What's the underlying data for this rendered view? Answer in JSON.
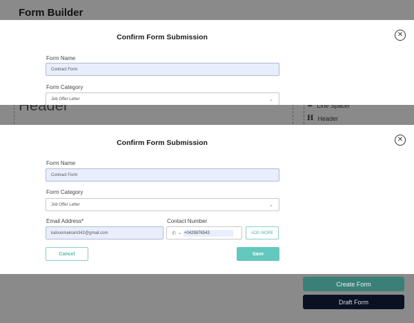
{
  "app": {
    "title": "Form Builder"
  },
  "background": {
    "header_text": "Header",
    "sidebar_items": [
      {
        "icon": "spacer-icon",
        "glyph": "≡",
        "label": "Line Spacer"
      },
      {
        "icon": "header-icon",
        "glyph": "H",
        "label": "Header"
      }
    ],
    "create_form_label": "Create Form",
    "draft_form_label": "Draft Form"
  },
  "modal_top": {
    "title": "Confirm Form Submission",
    "form_name_label": "Form Name",
    "form_name_value": "Contract Form",
    "form_category_label": "Form Category",
    "form_category_value": "Job Offer Letter"
  },
  "modal": {
    "title": "Confirm Form Submission",
    "form_name_label": "Form Name",
    "form_name_value": "Contract Form",
    "form_category_label": "Form Category",
    "form_category_value": "Job Offer Letter",
    "email_label": "Email Address*",
    "email_value": "kalsoomakram342@gmail.com",
    "contact_label": "Contact Number",
    "contact_value": "+0429876543",
    "add_more_label": "ADD MORE",
    "cancel_label": "Cancel",
    "save_label": "Save"
  },
  "colors": {
    "accent": "#63c8bd",
    "field_fill": "#e8eefc",
    "create_button": "#3a7f78",
    "draft_button": "#0a1122",
    "overlay": "#8a8a8a"
  }
}
